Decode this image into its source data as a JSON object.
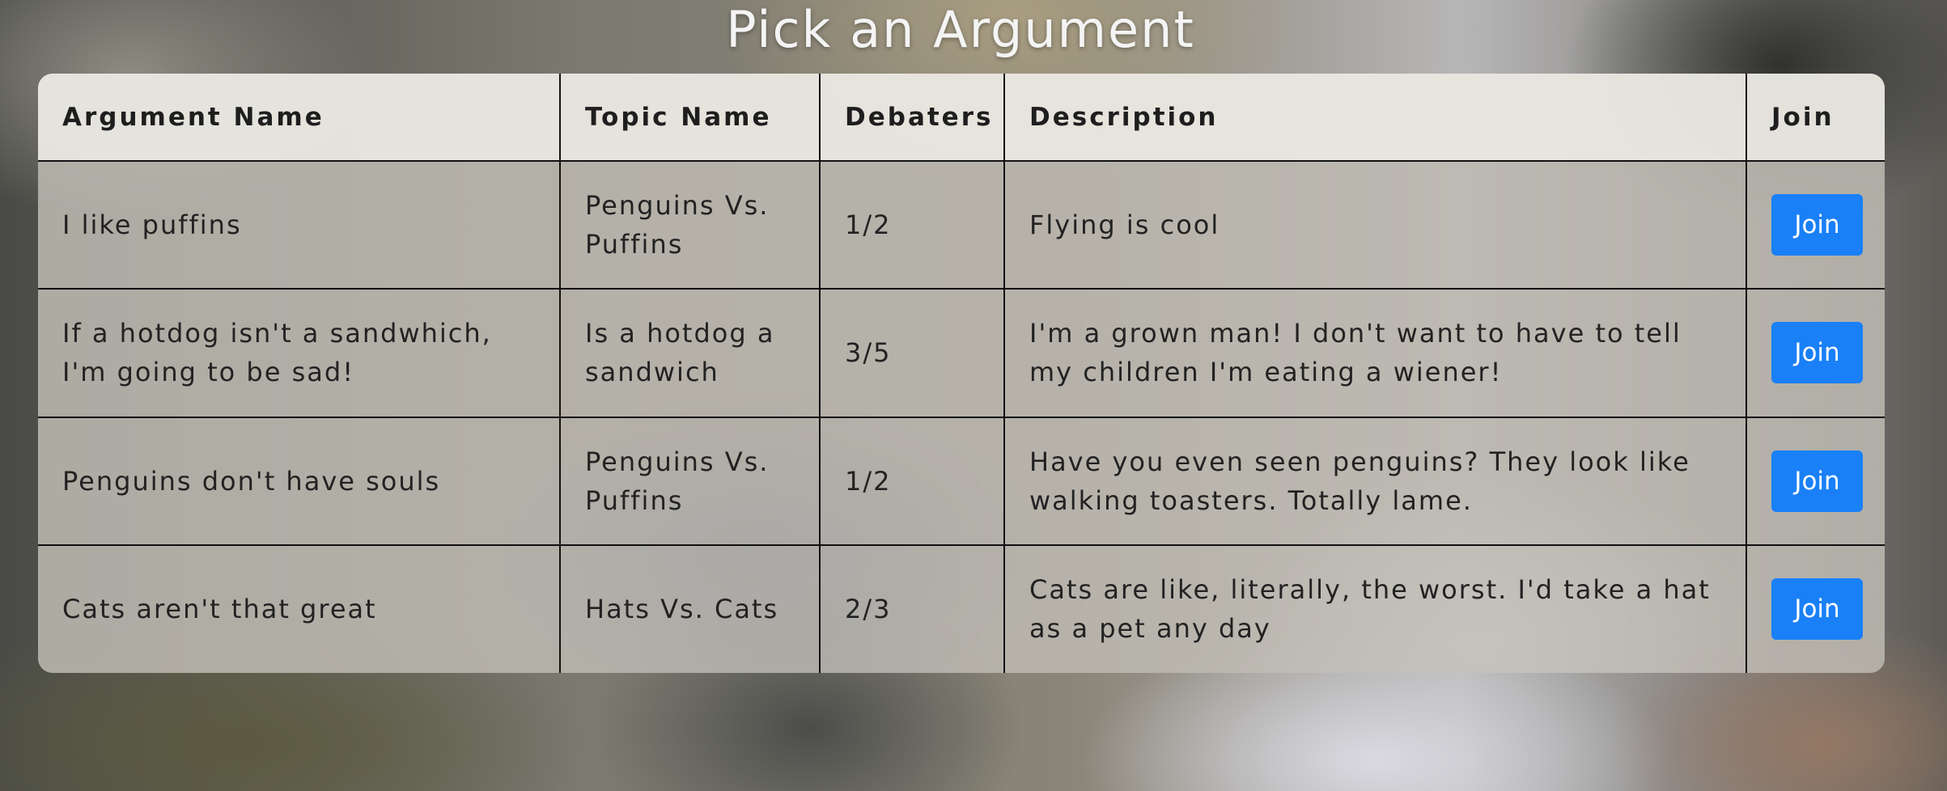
{
  "page": {
    "title": "Pick an Argument"
  },
  "table": {
    "headers": [
      "Argument Name",
      "Topic Name",
      "Debaters",
      "Description",
      "Join"
    ],
    "rows": [
      {
        "argument_name": "I like puffins",
        "topic_name": "Penguins Vs. Puffins",
        "debaters": "1/2",
        "description": "Flying is cool",
        "join_label": "Join"
      },
      {
        "argument_name": "If a hotdog isn't a sandwhich, I'm going to be sad!",
        "topic_name": "Is a hotdog a sandwich",
        "debaters": "3/5",
        "description": "I'm a grown man! I don't want to have to tell my children I'm eating a wiener!",
        "join_label": "Join"
      },
      {
        "argument_name": "Penguins don't have souls",
        "topic_name": "Penguins Vs. Puffins",
        "debaters": "1/2",
        "description": "Have you even seen penguins? They look like walking toasters. Totally lame.",
        "join_label": "Join"
      },
      {
        "argument_name": "Cats aren't that great",
        "topic_name": "Hats Vs. Cats",
        "debaters": "2/3",
        "description": "Cats are like, literally, the worst. I'd take a hat as a pet any day",
        "join_label": "Join"
      }
    ]
  },
  "colors": {
    "join_button": "#1a80f7",
    "title_text": "#f4f4f4",
    "border": "#111111"
  }
}
